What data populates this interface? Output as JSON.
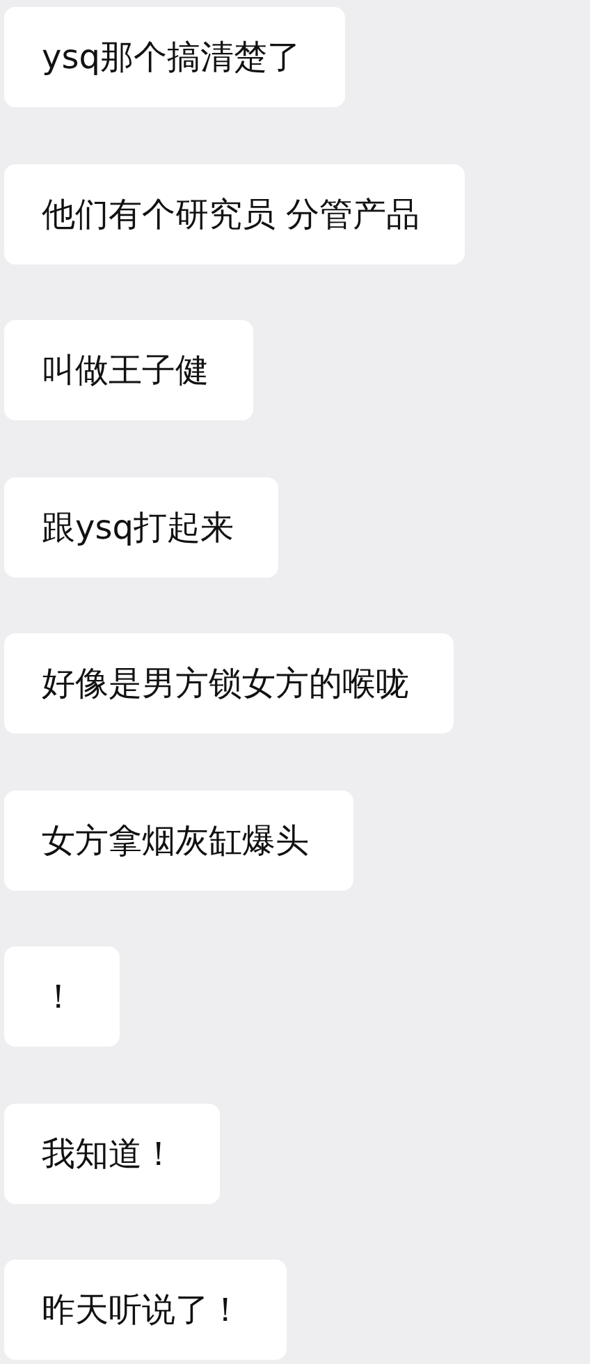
{
  "messages": [
    {
      "text": "ysq那个搞清楚了"
    },
    {
      "text": "他们有个研究员 分管产品"
    },
    {
      "text": "叫做王子健"
    },
    {
      "text": "跟ysq打起来"
    },
    {
      "text": "好像是男方锁女方的喉咙"
    },
    {
      "text": "女方拿烟灰缸爆头"
    },
    {
      "text": "！"
    },
    {
      "text": "我知道！"
    },
    {
      "text": "昨天听说了！"
    }
  ]
}
